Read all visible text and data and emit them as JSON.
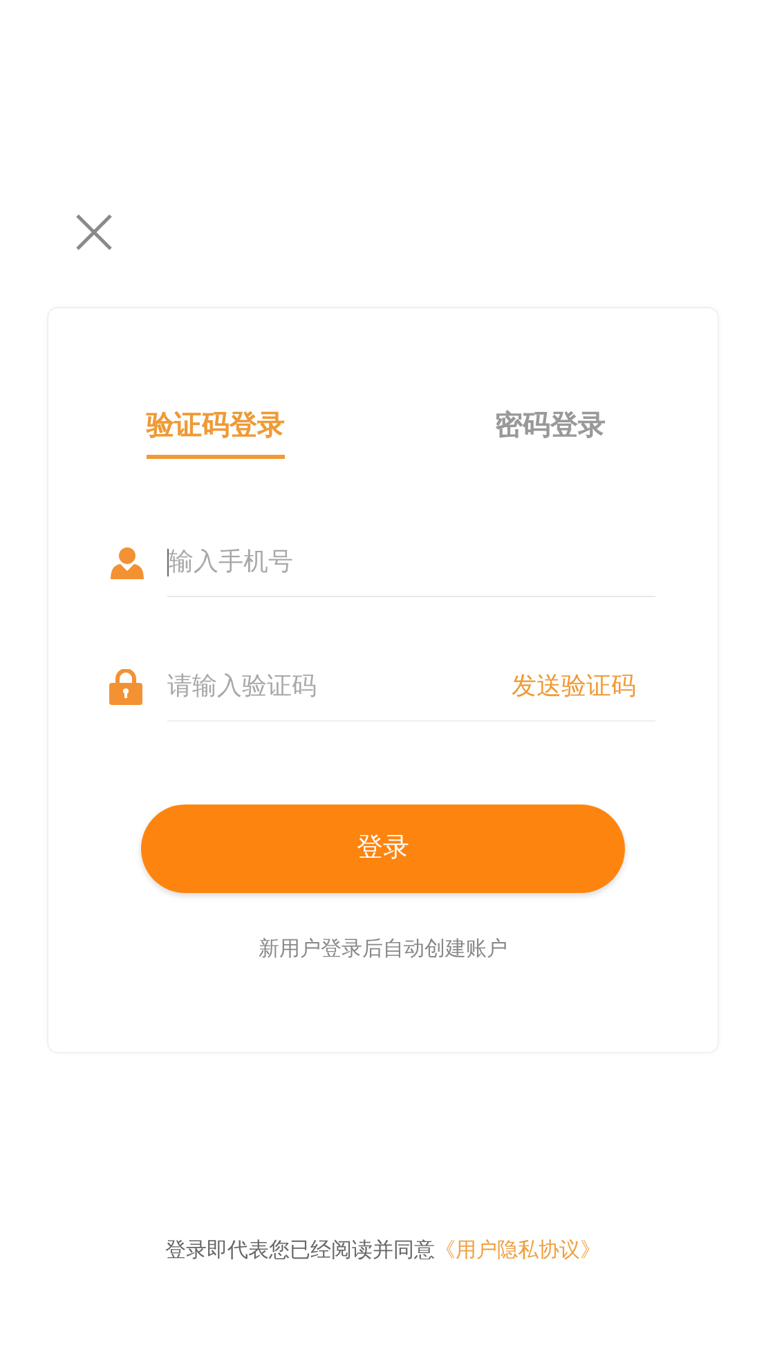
{
  "tabs": [
    {
      "label": "验证码登录",
      "selected": true
    },
    {
      "label": "密码登录",
      "selected": false
    }
  ],
  "fields": [
    {
      "kind": "phone",
      "placeholder": "输入手机号",
      "focused": true
    },
    {
      "kind": "code",
      "placeholder": "请输入验证码",
      "focused": false,
      "action": "发送验证码"
    }
  ],
  "login_button": "登录",
  "note": "新用户登录后自动创建账户",
  "footer": {
    "text": "登录即代表您已经阅读并同意",
    "link": "《用户隐私协议》"
  }
}
